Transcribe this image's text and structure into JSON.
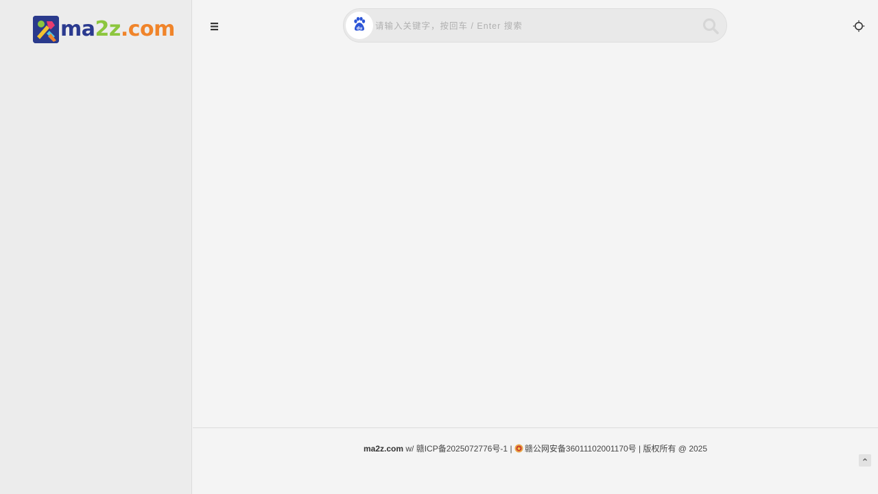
{
  "sidebar": {
    "logo": {
      "icon": "wrench-tools-logo-icon",
      "text_part1": "ma",
      "text_part2": "2z",
      "text_part3": ".com",
      "colors": {
        "part1": "#2b3a8f",
        "part2": "#8cc63e",
        "part3": "#f0842a"
      }
    }
  },
  "header": {
    "menu_icon": "hamburger-menu-icon",
    "search": {
      "engine_icon": "baidu-paw-icon",
      "placeholder": "请输入关键字，按回车 / Enter 搜索",
      "value": "",
      "button_icon": "search-icon"
    },
    "theme_icon": "sun-theme-toggle-icon"
  },
  "footer": {
    "site": "ma2z.com",
    "sep1": " w/ ",
    "icp": "赣ICP备2025072776号-1",
    "sep2": " | ",
    "police_icon": "police-badge-icon",
    "police": "赣公网安备36011102001170号",
    "sep3": " | ",
    "copyright": "版权所有 @ 2025",
    "back_top_icon": "chevron-up-icon"
  }
}
